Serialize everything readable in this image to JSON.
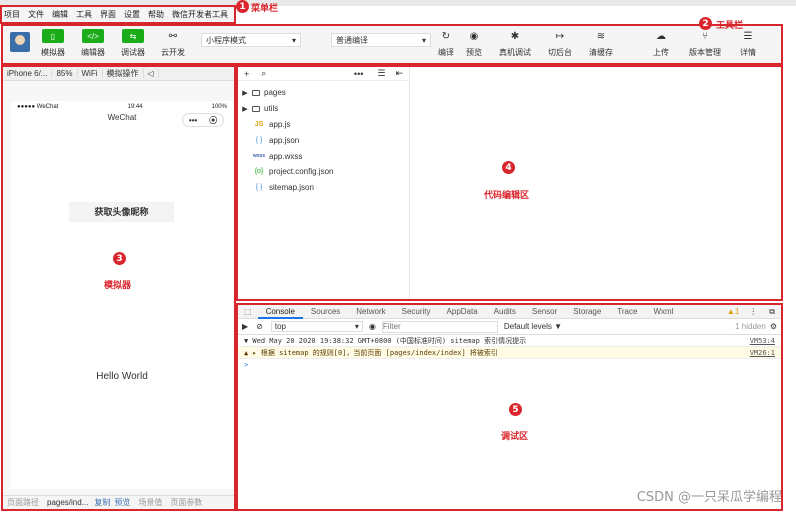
{
  "menubar": {
    "items": [
      "项目",
      "文件",
      "编辑",
      "工具",
      "界面",
      "设置",
      "帮助",
      "微信开发者工具"
    ]
  },
  "annotations": [
    {
      "num": "1",
      "label": "菜单栏"
    },
    {
      "num": "2",
      "label": "工具栏"
    },
    {
      "num": "3",
      "label": "模拟器"
    },
    {
      "num": "4",
      "label": "代码编辑区"
    },
    {
      "num": "5",
      "label": "调试区"
    }
  ],
  "toolbar": {
    "simulator_label": "模拟器",
    "editor_label": "编辑器",
    "debugger_label": "调试器",
    "cloud_label": "云开发",
    "mode_select": "小程序模式",
    "compile_select": "普通编译",
    "compile_label": "编译",
    "preview_label": "预览",
    "real_debug_label": "真机调试",
    "background_label": "切后台",
    "clear_cache_label": "清缓存",
    "upload_label": "上传",
    "version_label": "版本管理",
    "details_label": "详情"
  },
  "simulator": {
    "device": "iPhone 6/...",
    "zoom": "85%",
    "network": "WiFi",
    "operate": "模拟操作",
    "status_carrier": "●●●●● WeChat",
    "status_time": "19:44",
    "status_battery": "100%",
    "nav_title": "WeChat",
    "capsule_dots": "•••",
    "avatar_button": "获取头像昵称",
    "hello": "Hello World",
    "bottom_path_label": "页面路径",
    "bottom_path": "pages/ind...",
    "bottom_copy": "复制",
    "bottom_preview": "预览",
    "bottom_scene": "场景值",
    "bottom_params": "页面参数"
  },
  "filetree": {
    "folders": [
      "pages",
      "utils"
    ],
    "files": [
      {
        "name": "app.js",
        "icon": "JS"
      },
      {
        "name": "app.json",
        "icon": "{ }"
      },
      {
        "name": "app.wxss",
        "icon": "wxss"
      },
      {
        "name": "project.config.json",
        "icon": "{o}"
      },
      {
        "name": "sitemap.json",
        "icon": "{ }"
      }
    ]
  },
  "debug": {
    "tabs": [
      "Console",
      "Sources",
      "Network",
      "Security",
      "AppData",
      "Audits",
      "Sensor",
      "Storage",
      "Trace",
      "Wxml"
    ],
    "warn_count": "1",
    "context": "top",
    "filter_placeholder": "Filter",
    "levels": "Default levels ▼",
    "hidden": "1 hidden",
    "log_line": "▼ Wed May 20 2020 19:38:32 GMT+0800 (中国标准时间) sitemap 索引情况提示",
    "log_link": "VM53:4",
    "warn_line": "▲ ▸ 根据 sitemap 的规则[0]，当前页面 [pages/index/index] 将被索引",
    "warn_link": "VM26:1",
    "prompt": ">"
  },
  "watermark": "CSDN @一只呆瓜学编程",
  "colors": {
    "annotation_red": "#d9262c",
    "wechat_green": "#1aad19"
  }
}
